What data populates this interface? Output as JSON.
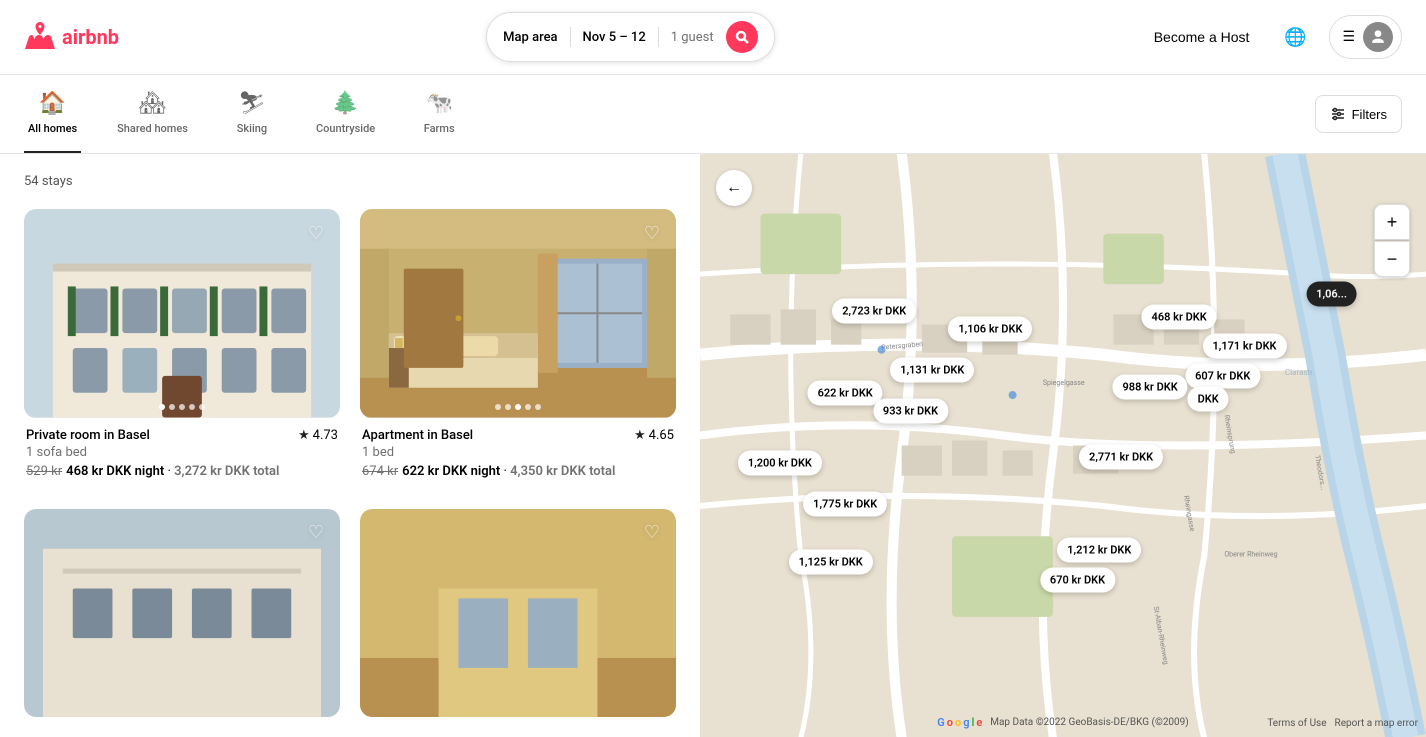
{
  "header": {
    "logo_alt": "Airbnb",
    "search": {
      "area_label": "Map area",
      "dates_label": "Nov 5 – 12",
      "guests_label": "1 guest",
      "search_button_label": "Search"
    },
    "become_host_label": "Become a Host",
    "user_menu_label": "User menu"
  },
  "category_nav": {
    "items": [
      {
        "id": "all-homes",
        "icon": "🏠",
        "label": "All homes",
        "active": true
      },
      {
        "id": "shared-homes",
        "icon": "🏘",
        "label": "Shared homes",
        "active": false
      },
      {
        "id": "skiing",
        "icon": "⛷",
        "label": "Skiing",
        "active": false
      },
      {
        "id": "countryside",
        "icon": "🌲",
        "label": "Countryside",
        "active": false
      },
      {
        "id": "farms",
        "icon": "🐄",
        "label": "Farms",
        "active": false
      }
    ],
    "filters_label": "Filters"
  },
  "listings": {
    "count_label": "54 stays",
    "cards": [
      {
        "id": "listing-1",
        "title": "Private room in Basel",
        "subtitle": "1 sofa bed",
        "rating": "4.73",
        "original_price": "529 kr",
        "price": "468 kr DKK",
        "price_unit": "night",
        "total": "3,272 kr DKK total",
        "type": "building",
        "dots": [
          "active",
          "",
          "",
          "",
          ""
        ]
      },
      {
        "id": "listing-2",
        "title": "Apartment in Basel",
        "subtitle": "1 bed",
        "rating": "4.65",
        "original_price": "674 kr",
        "price": "622 kr DKK",
        "price_unit": "night",
        "total": "4,350 kr DKK total",
        "type": "room",
        "dots": [
          "",
          "",
          "active",
          "",
          ""
        ]
      }
    ]
  },
  "map": {
    "back_button_label": "←",
    "zoom_in_label": "+",
    "zoom_out_label": "−",
    "price_bubbles": [
      {
        "id": "b1",
        "label": "2,723 kr DKK",
        "x": "24%",
        "y": "27%",
        "highlighted": false
      },
      {
        "id": "b2",
        "label": "1,106 kr DKK",
        "x": "40%",
        "y": "30%",
        "highlighted": false
      },
      {
        "id": "b3",
        "label": "468 kr DKK",
        "x": "66%",
        "y": "28%",
        "highlighted": false
      },
      {
        "id": "b4",
        "label": "1,171 kr DKK",
        "x": "75%",
        "y": "33%",
        "highlighted": false
      },
      {
        "id": "b5",
        "label": "607 kr DKK",
        "x": "72%",
        "y": "38%",
        "highlighted": false
      },
      {
        "id": "b6",
        "label": "988 kr DKK",
        "x": "62%",
        "y": "40%",
        "highlighted": false
      },
      {
        "id": "b7",
        "label": "DKK",
        "x": "70%",
        "y": "42%",
        "highlighted": false
      },
      {
        "id": "b8",
        "label": "1,131 kr DKK",
        "x": "32%",
        "y": "37%",
        "highlighted": false
      },
      {
        "id": "b9",
        "label": "622 kr DKK",
        "x": "20%",
        "y": "41%",
        "highlighted": false
      },
      {
        "id": "b10",
        "label": "933 kr DKK",
        "x": "29%",
        "y": "44%",
        "highlighted": false
      },
      {
        "id": "b11",
        "label": "2,771 kr DKK",
        "x": "58%",
        "y": "52%",
        "highlighted": false
      },
      {
        "id": "b12",
        "label": "1,200 kr DKK",
        "x": "11%",
        "y": "53%",
        "highlighted": false
      },
      {
        "id": "b13",
        "label": "1,775 kr DKK",
        "x": "20%",
        "y": "60%",
        "highlighted": false
      },
      {
        "id": "b14",
        "label": "1,06...",
        "x": "87%",
        "y": "24%",
        "highlighted": true
      },
      {
        "id": "b15",
        "label": "1,212 kr DKK",
        "x": "55%",
        "y": "68%",
        "highlighted": false
      },
      {
        "id": "b16",
        "label": "670 kr DKK",
        "x": "52%",
        "y": "73%",
        "highlighted": false
      },
      {
        "id": "b17",
        "label": "1,125 kr DKK",
        "x": "18%",
        "y": "70%",
        "highlighted": false
      }
    ],
    "attribution": "Map Data ©2022 GeoBasis-DE/BKG (©2009)",
    "terms_label": "Terms of Use",
    "report_label": "Report a map error"
  }
}
